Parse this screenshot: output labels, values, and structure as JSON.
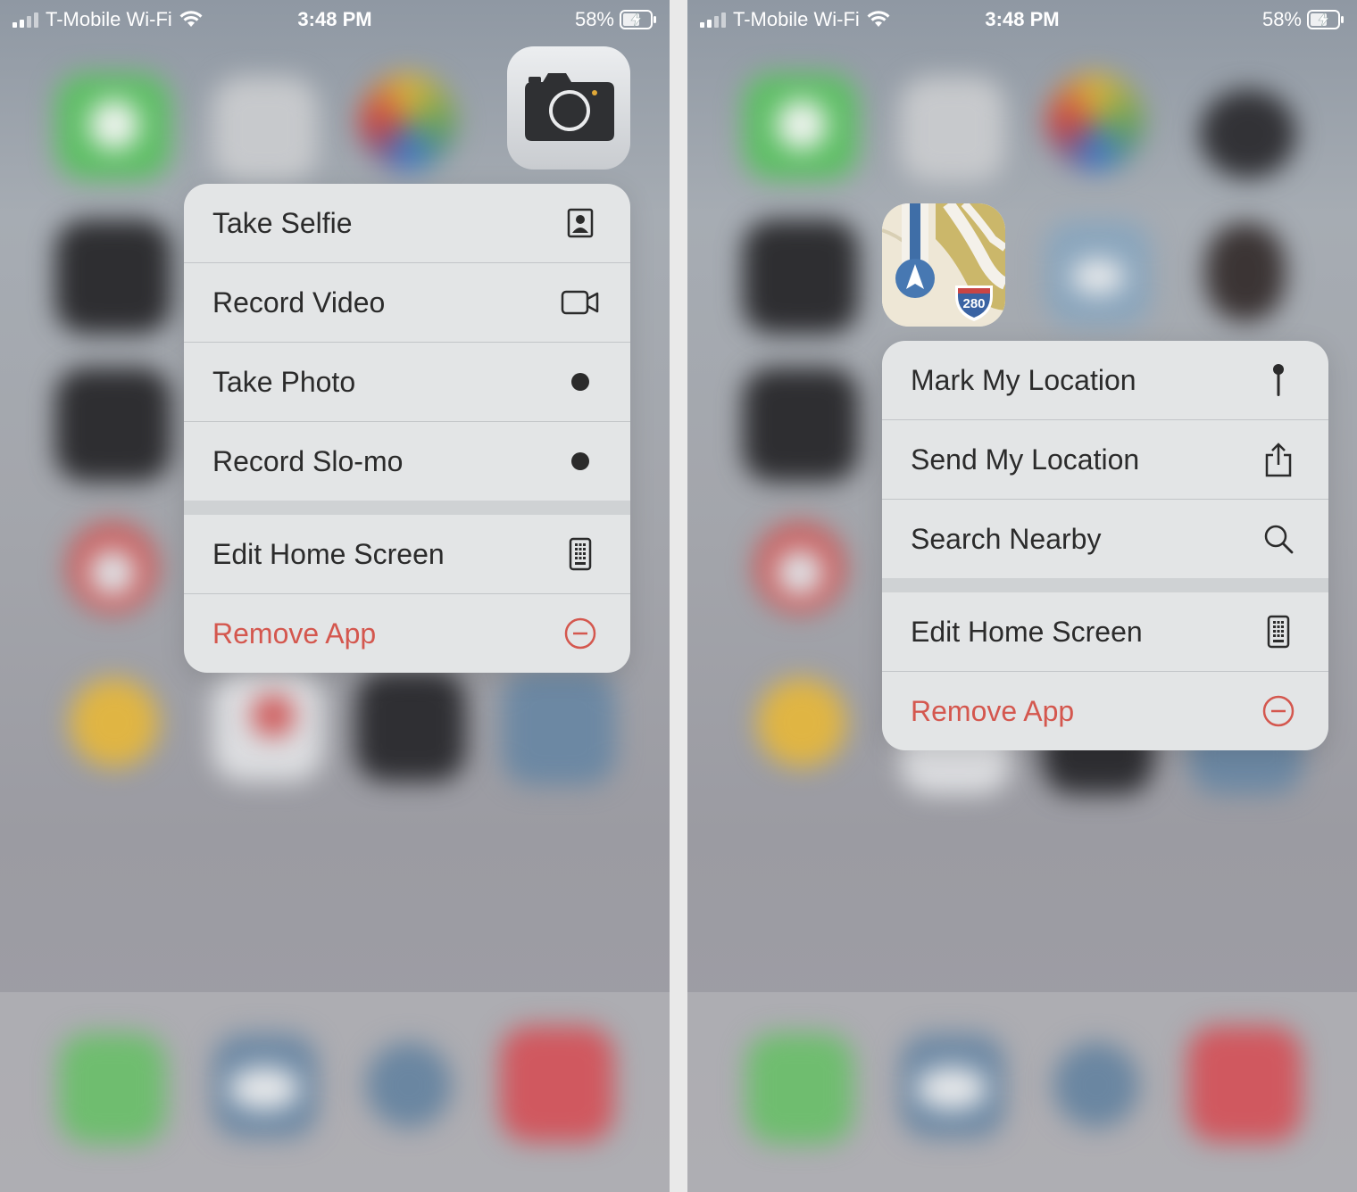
{
  "status": {
    "carrier": "T-Mobile Wi-Fi",
    "time": "3:48 PM",
    "battery": "58%"
  },
  "left": {
    "app_icon": "camera-icon",
    "menu": [
      {
        "label": "Take Selfie",
        "icon": "portrait-icon"
      },
      {
        "label": "Record Video",
        "icon": "video-camera-icon"
      },
      {
        "label": "Take Photo",
        "icon": "dot-icon"
      },
      {
        "label": "Record Slo-mo",
        "icon": "dot-icon"
      },
      {
        "label": "Edit Home Screen",
        "icon": "phone-grid-icon"
      },
      {
        "label": "Remove App",
        "icon": "minus-circle-icon",
        "destructive": true
      }
    ]
  },
  "right": {
    "app_icon": "maps-icon",
    "map_badge": "280",
    "menu": [
      {
        "label": "Mark My Location",
        "icon": "pin-icon"
      },
      {
        "label": "Send My Location",
        "icon": "share-icon"
      },
      {
        "label": "Search Nearby",
        "icon": "search-icon"
      },
      {
        "label": "Edit Home Screen",
        "icon": "phone-grid-icon"
      },
      {
        "label": "Remove App",
        "icon": "minus-circle-icon",
        "destructive": true
      }
    ]
  },
  "colors": {
    "menu_bg": "#e3e5e6",
    "destructive": "#d4574e",
    "text": "#2b2b2b"
  }
}
